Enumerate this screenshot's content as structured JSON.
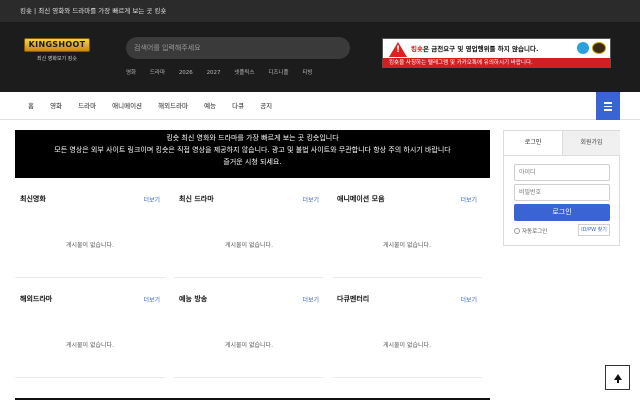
{
  "topbar": {
    "text": "킹숏 | 최신 영화와 드라마를 가장 빠르게 보는 곳 킹숏"
  },
  "header": {
    "logo_text": "KINGSHOOT",
    "logo_subtitle": "최신 영화보기 킹숏",
    "search_placeholder": "검색어를 입력해주세요",
    "keywords": [
      "영화",
      "드라마",
      "2026",
      "2027",
      "넷플릭스",
      "디즈니플",
      "티빙"
    ]
  },
  "banner": {
    "line1_brand": "킹숏",
    "line1_text": "은 금전요구 및 영업행위를 하지 않습니다.",
    "line2_text": "킹숏을 사칭하는 텔레그램 및 카카오톡에 유의하시기 바랍니다."
  },
  "nav": {
    "items": [
      "홈",
      "영화",
      "드라마",
      "애니메이션",
      "해외드라마",
      "예능",
      "다큐",
      "공지"
    ]
  },
  "notice": {
    "line1": "킹숏 최신 영화와 드라마를 가장 빠르게 보는 곳 킹숏입니다",
    "line2": "모든 영상은 외부 사이트 링크이며 킹숏은 직접 영상을 제공하지 않습니다. 광고 및 불법 사이트와 무관합니다 항상 주의 하시기 바랍니다",
    "line3": "즐거운 시청 되세요."
  },
  "boards": [
    {
      "title": "최신영화",
      "more": "더보기",
      "empty": "게시물이 없습니다."
    },
    {
      "title": "최신 드라마",
      "more": "더보기",
      "empty": "게시물이 없습니다."
    },
    {
      "title": "애니메이션 모음",
      "more": "더보기",
      "empty": "게시물이 없습니다."
    },
    {
      "title": "해외드라마",
      "more": "더보기",
      "empty": "게시물이 없습니다."
    },
    {
      "title": "예능 방송",
      "more": "더보기",
      "empty": "게시물이 없습니다."
    },
    {
      "title": "다큐멘터리",
      "more": "더보기",
      "empty": "게시물이 없습니다."
    }
  ],
  "login": {
    "tab_login": "로그인",
    "tab_register": "회원가입",
    "id_placeholder": "아이디",
    "pw_placeholder": "비밀번호",
    "login_button": "로그인",
    "auto_login": "자동로그인",
    "find_link": "ID/PW 찾기"
  },
  "colors": {
    "accent": "#3a64d4",
    "header_bg": "#1c1c1c",
    "warning": "#d31f1f"
  }
}
